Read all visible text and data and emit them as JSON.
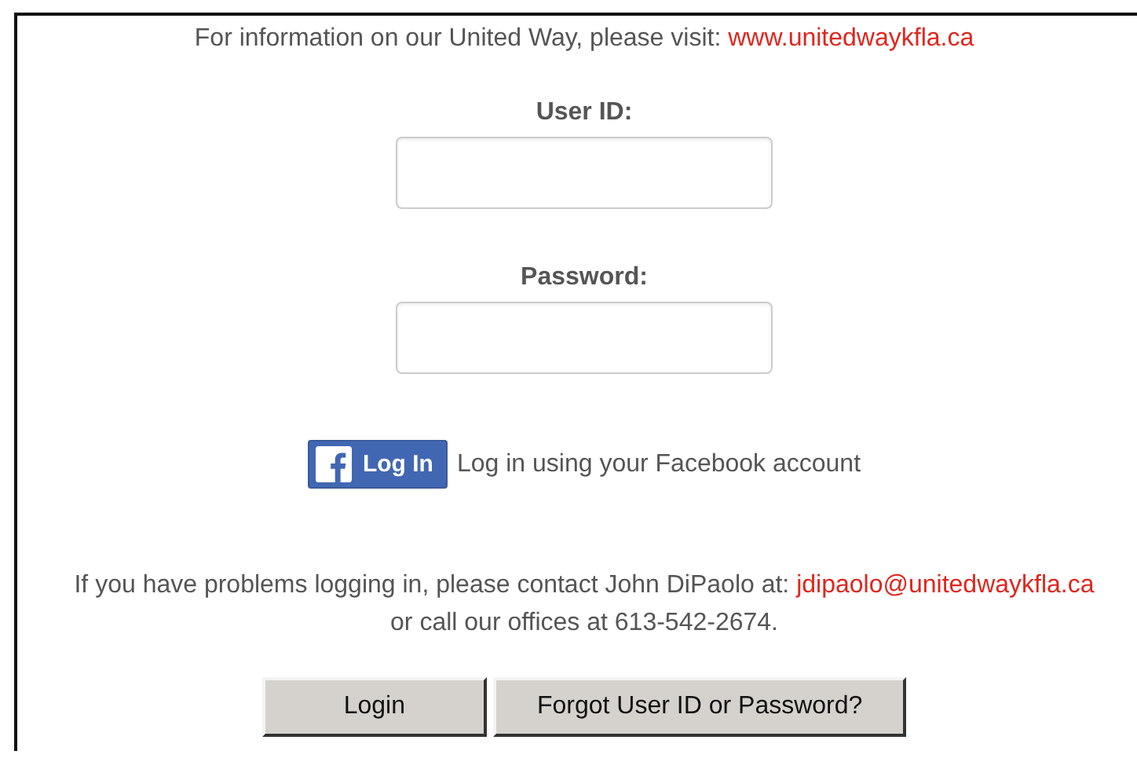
{
  "info": {
    "text": "For information on our United Way, please visit:",
    "link": "www.unitedwaykfla.ca"
  },
  "fields": [
    {
      "label": "User ID:"
    },
    {
      "label": "Password:"
    }
  ],
  "facebook": {
    "button": "Log In",
    "text": "Log in using your Facebook account"
  },
  "contact": {
    "text": "If you have problems logging in, please contact John DiPaolo at:",
    "email": "jdipaolo@unitedwaykfla.ca",
    "line2": "or call our offices at 613-542-2674."
  },
  "buttons": [
    "Login",
    "Forgot User ID or Password?"
  ]
}
